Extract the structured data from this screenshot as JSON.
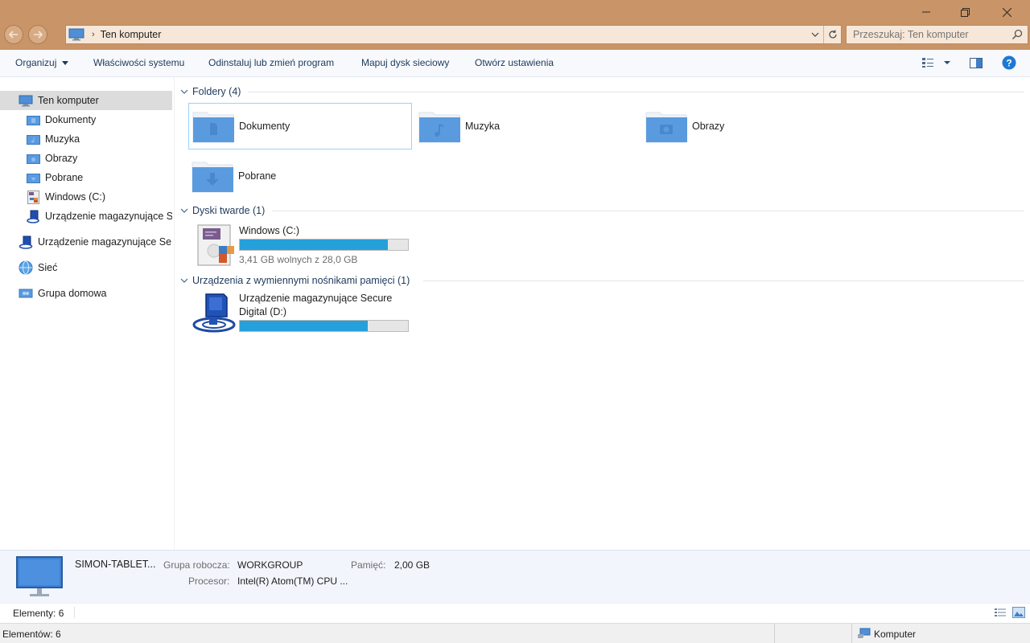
{
  "window": {
    "address_path": "Ten komputer",
    "search_placeholder": "Przeszukaj: Ten komputer",
    "title_color": "#c99467"
  },
  "toolbar": {
    "organize": "Organizuj",
    "system_properties": "Właściwości systemu",
    "uninstall": "Odinstaluj lub zmień program",
    "map_drive": "Mapuj dysk sieciowy",
    "open_settings": "Otwórz ustawienia"
  },
  "sidebar": {
    "items": [
      {
        "label": "Ten komputer",
        "icon": "computer-icon"
      },
      {
        "label": "Dokumenty",
        "icon": "documents-folder-icon"
      },
      {
        "label": "Muzyka",
        "icon": "music-folder-icon"
      },
      {
        "label": "Obrazy",
        "icon": "pictures-folder-icon"
      },
      {
        "label": "Pobrane",
        "icon": "downloads-folder-icon"
      },
      {
        "label": "Windows (C:)",
        "icon": "hard-drive-icon"
      },
      {
        "label": "Urządzenie magazynujące S",
        "icon": "sd-card-icon"
      },
      {
        "label": "Urządzenie magazynujące Se",
        "icon": "sd-card-icon"
      },
      {
        "label": "Sieć",
        "icon": "network-icon"
      },
      {
        "label": "Grupa domowa",
        "icon": "homegroup-icon"
      }
    ]
  },
  "groups": {
    "folders": {
      "header": "Foldery (4)",
      "items": [
        {
          "label": "Dokumenty",
          "icon": "documents-folder-icon"
        },
        {
          "label": "Muzyka",
          "icon": "music-folder-icon"
        },
        {
          "label": "Obrazy",
          "icon": "pictures-folder-icon"
        },
        {
          "label": "Pobrane",
          "icon": "downloads-folder-icon"
        }
      ]
    },
    "hard_drives": {
      "header": "Dyski twarde (1)",
      "items": [
        {
          "name": "Windows (C:)",
          "free_text": "3,41 GB wolnych z 28,0 GB",
          "used_fraction": 0.878
        }
      ]
    },
    "removable": {
      "header": "Urządzenia z wymiennymi nośnikami pamięci (1)",
      "items": [
        {
          "name_line1": "Urządzenie magazynujące Secure",
          "name_line2": "Digital (D:)",
          "used_fraction": 0.76
        }
      ]
    }
  },
  "details": {
    "computer_name": "SIMON-TABLET...",
    "workgroup_key": "Grupa robocza:",
    "workgroup_val": "WORKGROUP",
    "memory_key": "Pamięć:",
    "memory_val": "2,00 GB",
    "cpu_key": "Procesor:",
    "cpu_val": "Intel(R) Atom(TM) CPU  ..."
  },
  "status": {
    "elements": "Elementy: 6",
    "elements_bottom": "Elementów: 6",
    "computer": "Komputer"
  }
}
